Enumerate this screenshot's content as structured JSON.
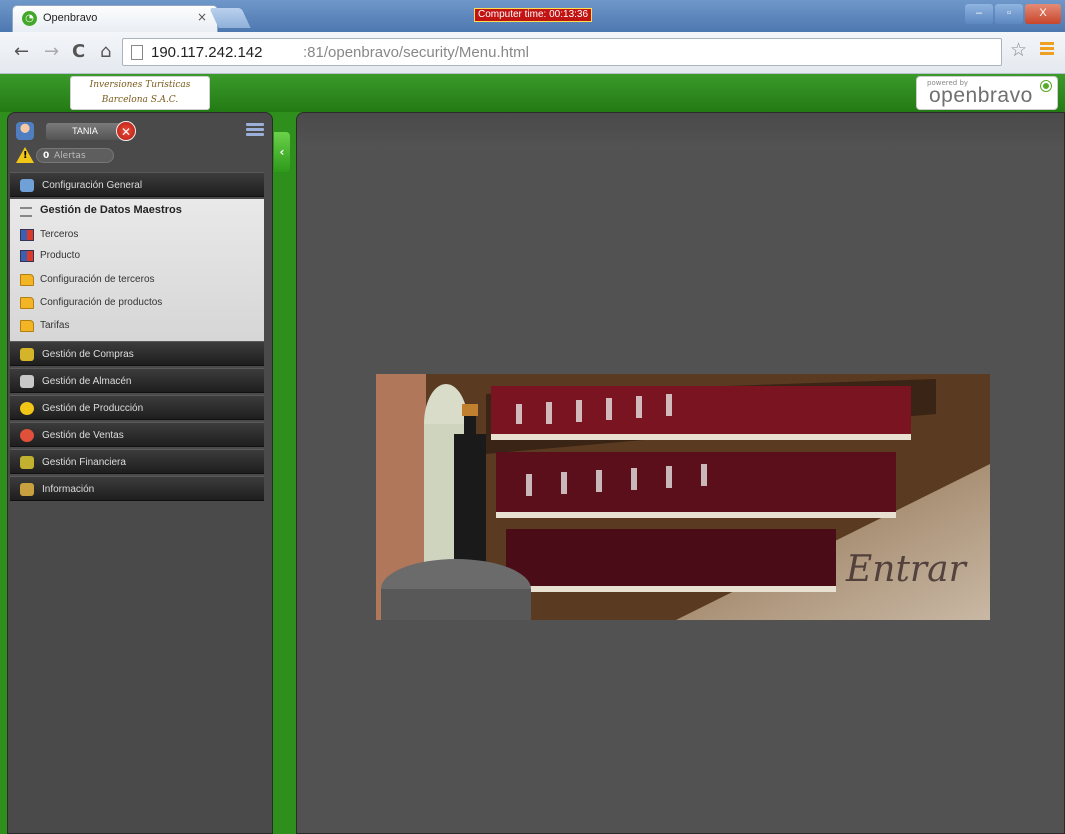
{
  "browser": {
    "tab_title": "Openbravo",
    "tab_close": "×",
    "favicon": "openbravo-icon",
    "clock": "Computer time: 00:13:36",
    "url_host": "190.117.242.142",
    "url_rest": ":81/openbravo/security/Menu.html",
    "btn_min": "–",
    "btn_max": "▫",
    "btn_close": "X"
  },
  "header": {
    "client_logo_line1": "Inversiones Turisticas",
    "client_logo_line2": "Barcelona S.A.C.",
    "powered_by": "powered by",
    "brand": "openbravo"
  },
  "user": {
    "name": "TANIA"
  },
  "alerts": {
    "count": "0",
    "label": "Alertas"
  },
  "menu": {
    "sections": [
      {
        "label": "Configuración General",
        "icon": "settings-icon",
        "color": "#6fa0d8"
      },
      {
        "label": "Gestión de Compras",
        "icon": "purchase-icon",
        "color": "#d6b42a"
      },
      {
        "label": "Gestión de Almacén",
        "icon": "warehouse-icon",
        "color": "#c9c9c9"
      },
      {
        "label": "Gestión de Producción",
        "icon": "production-icon",
        "color": "#f2c616"
      },
      {
        "label": "Gestión de Ventas",
        "icon": "sales-icon",
        "color": "#e0503a"
      },
      {
        "label": "Gestión Financiera",
        "icon": "finance-icon",
        "color": "#c2b030"
      },
      {
        "label": "Información",
        "icon": "info-icon",
        "color": "#c8a040"
      }
    ],
    "submenu": {
      "title": "Gestión de Datos Maestros",
      "items": [
        {
          "label": "Terceros",
          "icon": "window-icon"
        },
        {
          "label": "Producto",
          "icon": "window-icon"
        },
        {
          "label": "Configuración de terceros",
          "icon": "folder-icon"
        },
        {
          "label": "Configuración de productos",
          "icon": "folder-icon"
        },
        {
          "label": "Tarifas",
          "icon": "folder-icon"
        }
      ]
    }
  },
  "welcome": {
    "word": "Entrar"
  },
  "colors": {
    "brand_green": "#2e8f1c",
    "panel_dark": "#4a4a4a",
    "main_bg": "#525252"
  }
}
